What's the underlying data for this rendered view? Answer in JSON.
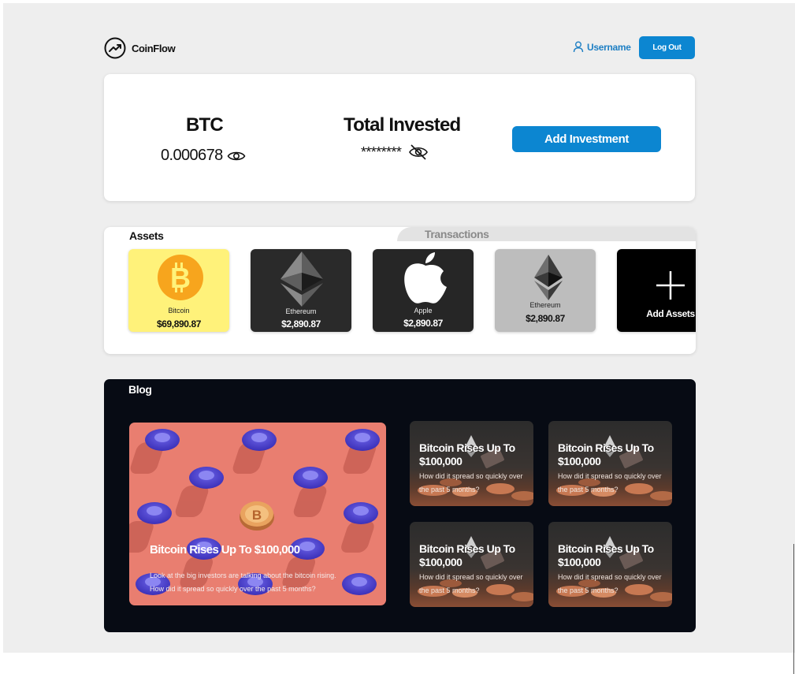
{
  "header": {
    "brand": "CoinFlow",
    "username": "Username",
    "logout_label": "Log Out"
  },
  "summary": {
    "btc_title": "BTC",
    "btc_value": "0.000678",
    "invested_title": "Total Invested",
    "invested_value": "********",
    "add_investment_label": "Add Investment"
  },
  "tabs": {
    "assets": "Assets",
    "transactions": "Transactions"
  },
  "assets": [
    {
      "name": "Bitcoin",
      "price": "$69,890.87",
      "icon": "bitcoin-icon",
      "bg": "#fff27a"
    },
    {
      "name": "Ethereum",
      "price": "$2,890.87",
      "icon": "ethereum-icon",
      "bg": "#2a2a2a"
    },
    {
      "name": "Apple",
      "price": "$2,890.87",
      "icon": "apple-icon",
      "bg": "#262626"
    },
    {
      "name": "Ethereum",
      "price": "$2,890.87",
      "icon": "ethereum-icon",
      "bg": "#bdbdbd"
    },
    {
      "name": "Add Assets",
      "icon": "plus-icon",
      "bg": "#000000"
    }
  ],
  "blog": {
    "title": "Blog",
    "featured": {
      "title": "Bitcoin Rises Up To $100,000",
      "excerpt": "Look at the big investors are talking about the bitcoin rising. How did it spread so quickly over the past 5 months?"
    },
    "posts": [
      {
        "title": "Bitcoin Rises Up To $100,000",
        "excerpt": "How did it spread so quickly over the past 5 months?"
      },
      {
        "title": "Bitcoin Rises Up To $100,000",
        "excerpt": "How did it spread so quickly over the past 5 months?"
      },
      {
        "title": "Bitcoin Rises Up To $100,000",
        "excerpt": "How did it spread so quickly over the past 5 months?"
      },
      {
        "title": "Bitcoin Rises Up To $100,000",
        "excerpt": "How did it spread so quickly over the past 5 months?"
      }
    ]
  },
  "colors": {
    "accent": "#0c86d1",
    "blog_bg": "#070b14",
    "featured_bg": "#e97e70"
  }
}
